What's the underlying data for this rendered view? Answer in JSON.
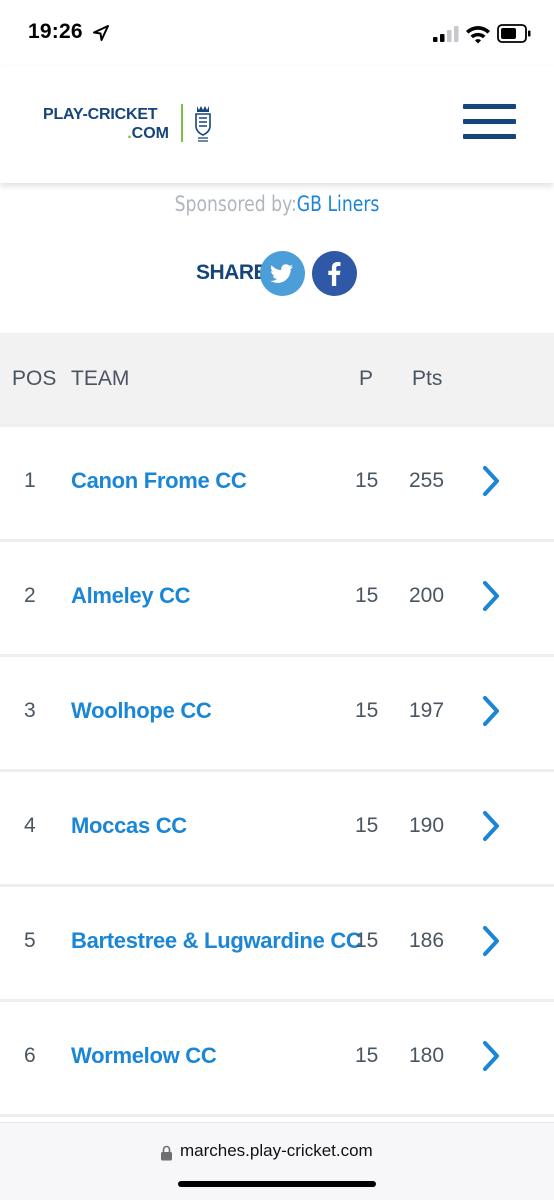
{
  "status_bar": {
    "time": "19:26",
    "icons": [
      "location-arrow-icon",
      "cellular-signal-icon",
      "wifi-icon",
      "battery-icon"
    ]
  },
  "header": {
    "logo_line1": "PLAY-CRICKET",
    "logo_line2_dot": ".",
    "logo_line2": "COM",
    "crest_icon": "ecb-crest-icon",
    "menu_icon": "hamburger-menu-icon"
  },
  "sponsor": {
    "label": "Sponsored by:",
    "name": "GB Liners"
  },
  "share": {
    "label": "SHARE",
    "buttons": [
      "twitter-icon",
      "facebook-icon"
    ]
  },
  "table": {
    "headers": {
      "pos": "POS",
      "team": "TEAM",
      "played": "P",
      "points": "Pts"
    },
    "rows": [
      {
        "pos": "1",
        "team": "Canon Frome CC",
        "played": "15",
        "points": "255"
      },
      {
        "pos": "2",
        "team": "Almeley CC",
        "played": "15",
        "points": "200"
      },
      {
        "pos": "3",
        "team": "Woolhope CC",
        "played": "15",
        "points": "197"
      },
      {
        "pos": "4",
        "team": "Moccas CC",
        "played": "15",
        "points": "190"
      },
      {
        "pos": "5",
        "team": "Bartestree & Lugwardine CC",
        "played": "15",
        "points": "186"
      },
      {
        "pos": "6",
        "team": "Wormelow CC",
        "played": "15",
        "points": "180"
      }
    ]
  },
  "browser": {
    "url": "marches.play-cricket.com"
  },
  "colors": {
    "brand_navy": "#15457a",
    "link_blue": "#1b86d6",
    "accent_green": "#7cbf3f",
    "twitter_blue": "#4c9ed9",
    "facebook_blue": "#2f58a7",
    "table_header_bg": "#f2f2f2"
  }
}
